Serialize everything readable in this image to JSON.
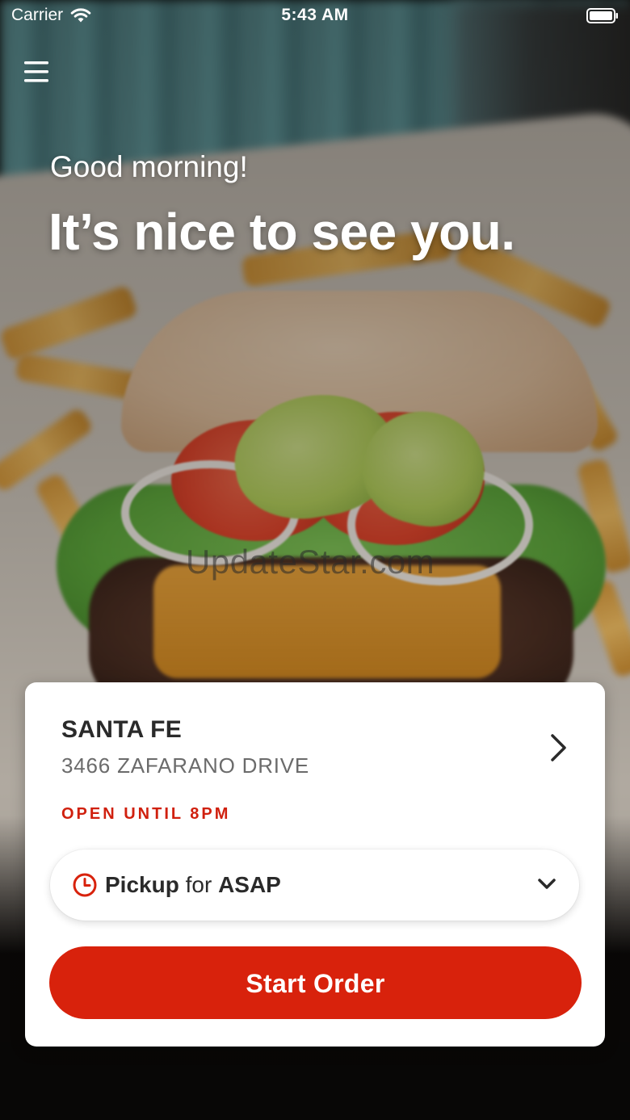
{
  "status_bar": {
    "carrier": "Carrier",
    "time": "5:43 AM"
  },
  "greeting": {
    "salutation": "Good morning!",
    "headline": "It’s nice to see you."
  },
  "watermark": "UpdateStar.com",
  "location": {
    "name": "SANTA FE",
    "address": "3466 ZAFARANO DRIVE",
    "hours_status": "OPEN UNTIL 8PM"
  },
  "order_type": {
    "mode": "Pickup",
    "connector": "for",
    "time": "ASAP"
  },
  "actions": {
    "start_order": "Start Order"
  },
  "icons": {
    "menu": "hamburger-menu-icon",
    "wifi": "wifi-icon",
    "battery": "battery-icon",
    "chevron_right": "chevron-right-icon",
    "clock": "clock-icon",
    "chevron_down": "chevron-down-icon"
  },
  "colors": {
    "accent": "#d8220c",
    "status_text": "#d0200e",
    "card_background": "#ffffff",
    "text_primary": "#2a2a2a",
    "text_secondary": "#6b6b6b"
  }
}
